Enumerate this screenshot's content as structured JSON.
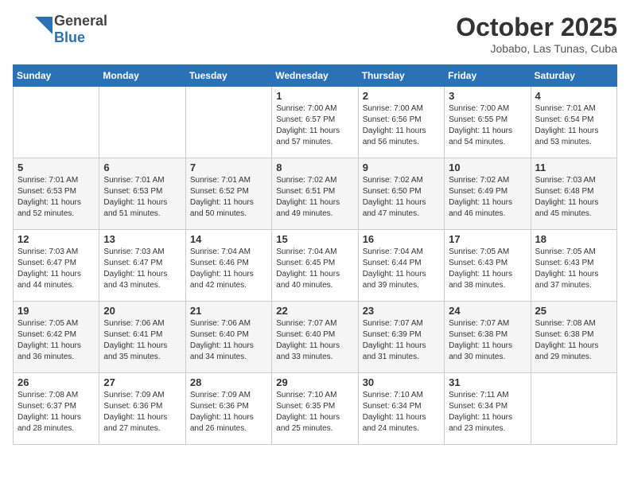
{
  "header": {
    "logo": {
      "line1": "General",
      "line2": "Blue"
    },
    "title": "October 2025",
    "location": "Jobabo, Las Tunas, Cuba"
  },
  "days_of_week": [
    "Sunday",
    "Monday",
    "Tuesday",
    "Wednesday",
    "Thursday",
    "Friday",
    "Saturday"
  ],
  "weeks": [
    [
      {
        "day": "",
        "info": ""
      },
      {
        "day": "",
        "info": ""
      },
      {
        "day": "",
        "info": ""
      },
      {
        "day": "1",
        "info": "Sunrise: 7:00 AM\nSunset: 6:57 PM\nDaylight: 11 hours\nand 57 minutes."
      },
      {
        "day": "2",
        "info": "Sunrise: 7:00 AM\nSunset: 6:56 PM\nDaylight: 11 hours\nand 56 minutes."
      },
      {
        "day": "3",
        "info": "Sunrise: 7:00 AM\nSunset: 6:55 PM\nDaylight: 11 hours\nand 54 minutes."
      },
      {
        "day": "4",
        "info": "Sunrise: 7:01 AM\nSunset: 6:54 PM\nDaylight: 11 hours\nand 53 minutes."
      }
    ],
    [
      {
        "day": "5",
        "info": "Sunrise: 7:01 AM\nSunset: 6:53 PM\nDaylight: 11 hours\nand 52 minutes."
      },
      {
        "day": "6",
        "info": "Sunrise: 7:01 AM\nSunset: 6:53 PM\nDaylight: 11 hours\nand 51 minutes."
      },
      {
        "day": "7",
        "info": "Sunrise: 7:01 AM\nSunset: 6:52 PM\nDaylight: 11 hours\nand 50 minutes."
      },
      {
        "day": "8",
        "info": "Sunrise: 7:02 AM\nSunset: 6:51 PM\nDaylight: 11 hours\nand 49 minutes."
      },
      {
        "day": "9",
        "info": "Sunrise: 7:02 AM\nSunset: 6:50 PM\nDaylight: 11 hours\nand 47 minutes."
      },
      {
        "day": "10",
        "info": "Sunrise: 7:02 AM\nSunset: 6:49 PM\nDaylight: 11 hours\nand 46 minutes."
      },
      {
        "day": "11",
        "info": "Sunrise: 7:03 AM\nSunset: 6:48 PM\nDaylight: 11 hours\nand 45 minutes."
      }
    ],
    [
      {
        "day": "12",
        "info": "Sunrise: 7:03 AM\nSunset: 6:47 PM\nDaylight: 11 hours\nand 44 minutes."
      },
      {
        "day": "13",
        "info": "Sunrise: 7:03 AM\nSunset: 6:47 PM\nDaylight: 11 hours\nand 43 minutes."
      },
      {
        "day": "14",
        "info": "Sunrise: 7:04 AM\nSunset: 6:46 PM\nDaylight: 11 hours\nand 42 minutes."
      },
      {
        "day": "15",
        "info": "Sunrise: 7:04 AM\nSunset: 6:45 PM\nDaylight: 11 hours\nand 40 minutes."
      },
      {
        "day": "16",
        "info": "Sunrise: 7:04 AM\nSunset: 6:44 PM\nDaylight: 11 hours\nand 39 minutes."
      },
      {
        "day": "17",
        "info": "Sunrise: 7:05 AM\nSunset: 6:43 PM\nDaylight: 11 hours\nand 38 minutes."
      },
      {
        "day": "18",
        "info": "Sunrise: 7:05 AM\nSunset: 6:43 PM\nDaylight: 11 hours\nand 37 minutes."
      }
    ],
    [
      {
        "day": "19",
        "info": "Sunrise: 7:05 AM\nSunset: 6:42 PM\nDaylight: 11 hours\nand 36 minutes."
      },
      {
        "day": "20",
        "info": "Sunrise: 7:06 AM\nSunset: 6:41 PM\nDaylight: 11 hours\nand 35 minutes."
      },
      {
        "day": "21",
        "info": "Sunrise: 7:06 AM\nSunset: 6:40 PM\nDaylight: 11 hours\nand 34 minutes."
      },
      {
        "day": "22",
        "info": "Sunrise: 7:07 AM\nSunset: 6:40 PM\nDaylight: 11 hours\nand 33 minutes."
      },
      {
        "day": "23",
        "info": "Sunrise: 7:07 AM\nSunset: 6:39 PM\nDaylight: 11 hours\nand 31 minutes."
      },
      {
        "day": "24",
        "info": "Sunrise: 7:07 AM\nSunset: 6:38 PM\nDaylight: 11 hours\nand 30 minutes."
      },
      {
        "day": "25",
        "info": "Sunrise: 7:08 AM\nSunset: 6:38 PM\nDaylight: 11 hours\nand 29 minutes."
      }
    ],
    [
      {
        "day": "26",
        "info": "Sunrise: 7:08 AM\nSunset: 6:37 PM\nDaylight: 11 hours\nand 28 minutes."
      },
      {
        "day": "27",
        "info": "Sunrise: 7:09 AM\nSunset: 6:36 PM\nDaylight: 11 hours\nand 27 minutes."
      },
      {
        "day": "28",
        "info": "Sunrise: 7:09 AM\nSunset: 6:36 PM\nDaylight: 11 hours\nand 26 minutes."
      },
      {
        "day": "29",
        "info": "Sunrise: 7:10 AM\nSunset: 6:35 PM\nDaylight: 11 hours\nand 25 minutes."
      },
      {
        "day": "30",
        "info": "Sunrise: 7:10 AM\nSunset: 6:34 PM\nDaylight: 11 hours\nand 24 minutes."
      },
      {
        "day": "31",
        "info": "Sunrise: 7:11 AM\nSunset: 6:34 PM\nDaylight: 11 hours\nand 23 minutes."
      },
      {
        "day": "",
        "info": ""
      }
    ]
  ]
}
